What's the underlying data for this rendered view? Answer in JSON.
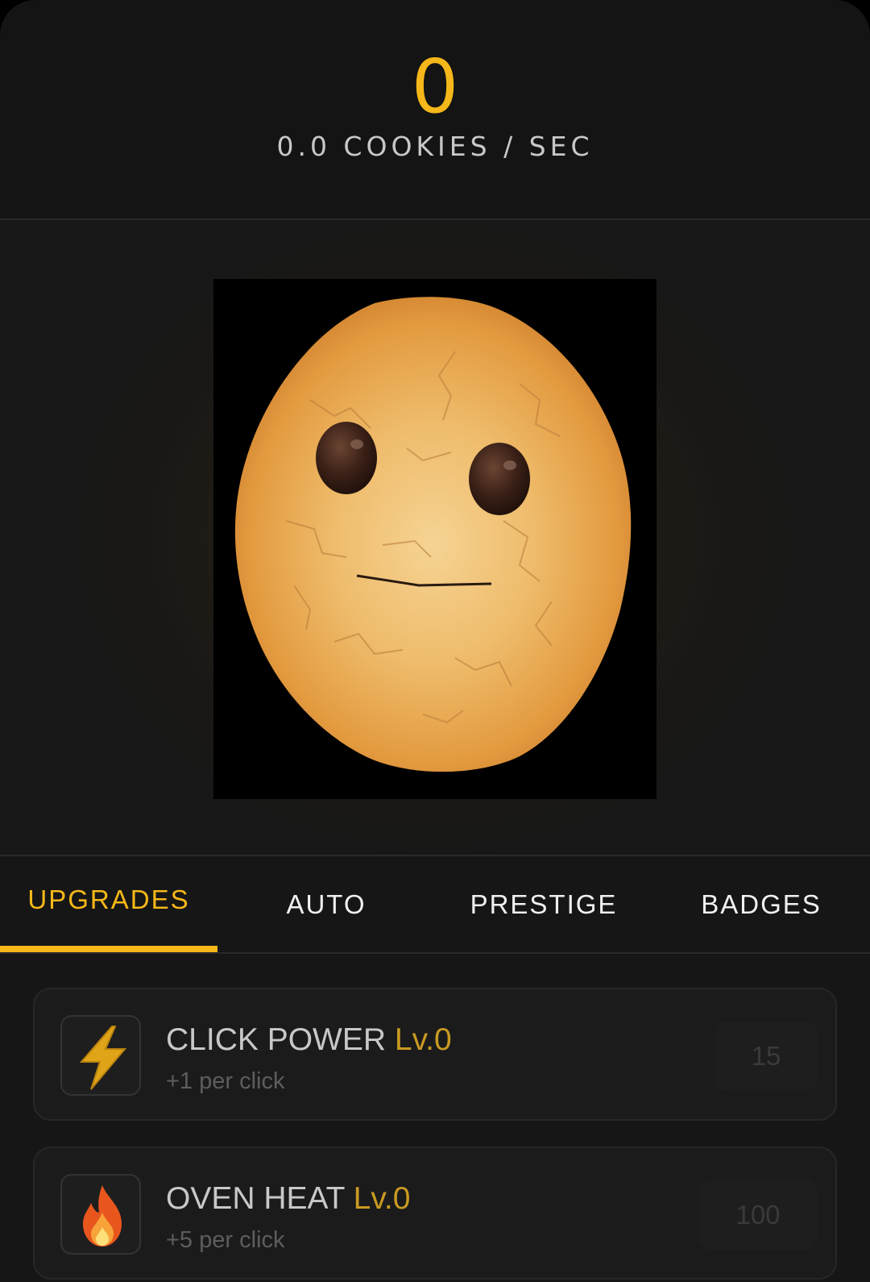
{
  "header": {
    "cookie_count": "0",
    "rate_label": "0.0 COOKIES / SEC"
  },
  "cookie": {
    "icon": "cookie-face-image"
  },
  "tabs": [
    {
      "label": "UPGRADES",
      "active": true
    },
    {
      "label": "AUTO",
      "active": false
    },
    {
      "label": "PRESTIGE",
      "active": false
    },
    {
      "label": "BADGES",
      "active": false
    }
  ],
  "upgrades": [
    {
      "icon": "lightning-icon",
      "name": "CLICK POWER",
      "level": "Lv.0",
      "desc": "+1 per click",
      "price": "15"
    },
    {
      "icon": "flame-icon",
      "name": "OVEN HEAT",
      "level": "Lv.0",
      "desc": "+5 per click",
      "price": "100"
    }
  ],
  "colors": {
    "accent": "#f5b719",
    "level": "#c99a22",
    "background": "#161616"
  }
}
